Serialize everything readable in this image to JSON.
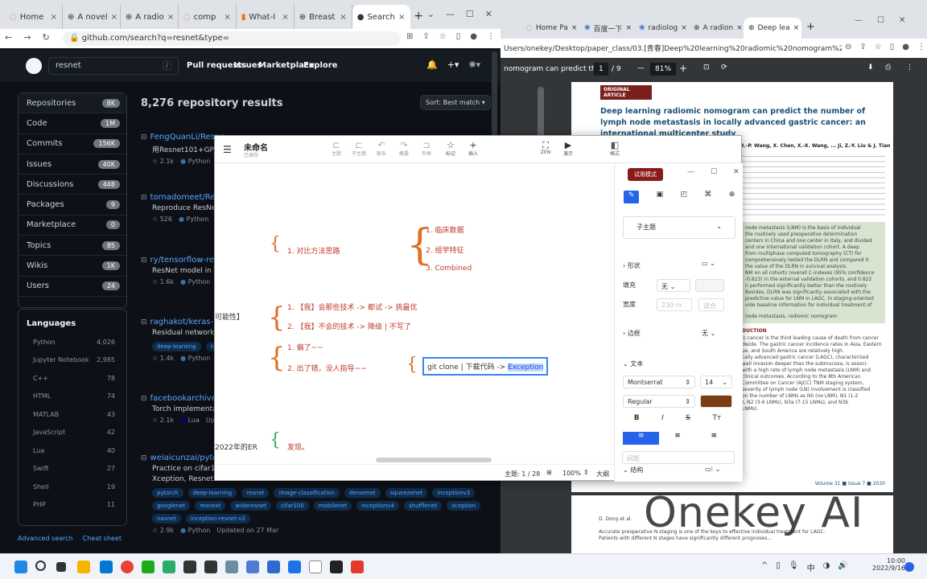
{
  "left_browser": {
    "tabs": [
      {
        "label": "Home"
      },
      {
        "label": "A novel"
      },
      {
        "label": "A radio"
      },
      {
        "label": "comp"
      },
      {
        "label": "What-I"
      },
      {
        "label": "Breast"
      },
      {
        "label": "Search"
      }
    ],
    "url": "github.com/search?q=resnet&type=",
    "search_value": "resnet",
    "nav": [
      "Pull requests",
      "Issues",
      "Marketplace",
      "Explore"
    ],
    "sidebar": [
      {
        "label": "Repositories",
        "count": "8K"
      },
      {
        "label": "Code",
        "count": "1M"
      },
      {
        "label": "Commits",
        "count": "156K"
      },
      {
        "label": "Issues",
        "count": "40K"
      },
      {
        "label": "Discussions",
        "count": "448"
      },
      {
        "label": "Packages",
        "count": "9"
      },
      {
        "label": "Marketplace",
        "count": "0"
      },
      {
        "label": "Topics",
        "count": "85"
      },
      {
        "label": "Wikis",
        "count": "1K"
      },
      {
        "label": "Users",
        "count": "24"
      }
    ],
    "languages_title": "Languages",
    "languages": [
      {
        "name": "Python",
        "count": "4,026"
      },
      {
        "name": "Jupyter Notebook",
        "count": "2,985"
      },
      {
        "name": "C++",
        "count": "78"
      },
      {
        "name": "HTML",
        "count": "74"
      },
      {
        "name": "MATLAB",
        "count": "43"
      },
      {
        "name": "JavaScript",
        "count": "42"
      },
      {
        "name": "Lua",
        "count": "40"
      },
      {
        "name": "Swift",
        "count": "27"
      },
      {
        "name": "Shell",
        "count": "19"
      },
      {
        "name": "PHP",
        "count": "11"
      }
    ],
    "results_title": "8,276 repository results",
    "sort_label": "Sort: Best match ▾",
    "footer_links": [
      "Advanced search",
      "Cheat sheet"
    ],
    "repos": [
      {
        "name": "FengQuanLi/Resne",
        "desc": "用Resnet101+GPT搭",
        "stars": "2.1k",
        "lang": "Python"
      },
      {
        "name": "tornadomeet/ResN",
        "desc": "Reproduce ResNet-v",
        "stars": "526",
        "lang": "Python"
      },
      {
        "name": "ry/tensorflow-resn",
        "desc": "ResNet model in Ten",
        "stars": "1.6k",
        "lang": "Python"
      },
      {
        "name": "raghakot/keras-res",
        "desc": "Residual networks im",
        "stars": "1.4k",
        "lang": "Python",
        "topics": [
          "deep-learning",
          "kera"
        ]
      },
      {
        "name": "facebookarchive/fl",
        "desc": "Torch implementation",
        "stars": "2.1k",
        "lang": "Lua",
        "extra": "Upd"
      },
      {
        "name": "weiaicunzai/pytorc",
        "desc": "Practice on cifar100(I",
        "desc2": "Xception, Resnet ...",
        "stars": "2.9k",
        "lang": "Python",
        "updated": "Updated on 27 Mar",
        "topics": [
          "pytorch",
          "deep-learning",
          "resnet",
          "image-classification",
          "densenet",
          "squeezenet",
          "inceptionv3",
          "googlenet",
          "resnext",
          "wideresnet",
          "cifar100",
          "mobilenet",
          "inceptionv4",
          "shufflenet",
          "xception",
          "nasnet",
          "inception-resnet-v2"
        ]
      }
    ]
  },
  "right_browser": {
    "tabs": [
      {
        "label": "Home Pa"
      },
      {
        "label": "百度一下"
      },
      {
        "label": "radiolog"
      },
      {
        "label": "A radion"
      },
      {
        "label": "Deep lea"
      }
    ],
    "url": "Users/onekey/Desktop/paper_class/03.[青春]Deep%20learning%20radiomic%20nomogram%20can%...",
    "pdf_title": "nomogram can predict th...",
    "page": "1",
    "pages": "/ 9",
    "zoom": "81%",
    "article_type": "ORIGINAL ARTICLE",
    "article_title": "Deep learning radiomic nomogram can predict the number of lymph node metastasis in locally advanced gastric cancer: an international multicenter study",
    "authors": "R.-P. Wang, X. Chen, X.-X. Wang, ... Ji, Z.-Y. Liu & J. Tian",
    "abstract_lines": [
      "node metastasis (LNM) is the basis of individual",
      "the routinely used preoperative determination",
      "centers in China and one center in Italy, and divided",
      "and one international validation cohort. A deep",
      "from multiphase computed tomography (CT) for",
      "comprehensively tested the DLRN and compared it",
      "the value of the DLRN in survival analysis.",
      "NM on all cohorts (overall C-indexes (95% confidence",
      "-0.823) in the external validation cohorts, and 0.822",
      "n performed significantly better than the routinely",
      "Besides, DLRN was significantly associated with the",
      "predictive value for LNM in LAGC. In staging-oriented",
      "vide baseline information for individual treatment of"
    ],
    "keywords": "node metastasis, radiomic nomogram",
    "intro_heading": "DUCTION",
    "intro_lines": [
      "ic cancer is the third leading cause of death from cancer",
      "dwide. The gastric cancer incidence rates in Asia, Eastern",
      "pe, and South America are relatively high.",
      "cally advanced gastric cancer (LAGC), characterized",
      "wall invasion deeper than the submucosa, is associ-",
      "with a high rate of lymph node metastasis (LNM) and",
      "clinical outcomes. According to the 8th American",
      "Committee on Cancer (AJCC) TNM staging system,",
      "severity of lymph node (LN) involvement is classified",
      "on the number of LNMs as N0 (no LNM), N1 (1-2",
      "), N2 (3-6 LNMs), N3a (7-15 LNMs), and N3b",
      "LNMs)."
    ],
    "volume": "Volume 31 ■ Issue 7 ■ 2020",
    "page2_author": "D. Dong et al.",
    "page2_text": "Accurate preoperative N staging is one of the keys to effective individual treatment for LAGC. Patients with different N stages have significantly different prognoses...",
    "watermark": "Onekey AI"
  },
  "mindmap": {
    "title": "未命名",
    "subtitle": "已保存",
    "toolbar": [
      {
        "glyph": "⊏",
        "label": "主题"
      },
      {
        "glyph": "⊏",
        "label": "子主题"
      },
      {
        "glyph": "↶",
        "label": "联系"
      },
      {
        "glyph": "↷",
        "label": "概要"
      },
      {
        "glyph": "⊐",
        "label": "外框"
      },
      {
        "glyph": "☆",
        "label": "标记"
      },
      {
        "glyph": "+",
        "label": "插入"
      }
    ],
    "toolbar_right": [
      {
        "glyph": "⛶",
        "label": "ZEN"
      },
      {
        "glyph": "▶",
        "label": "演示"
      }
    ],
    "format_label": "格式",
    "trial_button": "试用模式",
    "nodes": {
      "n1": "1. 对比方法思路",
      "n1a": "1. 临床数据",
      "n1b": "2. 组学特征",
      "n1c": "3. Combined",
      "side": "可能性】",
      "n2a": "1. 【我】会那些技术 -> 都试 -> 挑最优",
      "n2b": "2. 【我】不会的技术 -> 降级 | 不写了",
      "n3a": "1. 偏了~~",
      "n3b": "2. 出了错，没人指导~~",
      "n3c_prefix": "git clone | 下载代码 -> ",
      "n3c_sel": "Exception",
      "n4": "2022年的ER",
      "n5": "发现。"
    },
    "panel": {
      "subtopic": "子主题",
      "shape": "形状",
      "fill": "填充",
      "fill_value": "无",
      "width": "宽度",
      "width_value": "230",
      "width_unit": "PX",
      "fit": "适合",
      "border": "边框",
      "border_value": "无",
      "text": "文本",
      "font": "Montserrat",
      "size": "14",
      "weight": "Regular",
      "text_color": "#7a3e12",
      "bold": "B",
      "italic": "I",
      "strike": "S",
      "case": "Tт",
      "structure": "结构",
      "spacing": "间距"
    },
    "status": {
      "topics": "主题: 1 / 28",
      "zoom": "100%",
      "size_label": "大纲"
    }
  },
  "taskbar": {
    "time": "10:00",
    "date": "2022/9/16",
    "lang": "中"
  }
}
